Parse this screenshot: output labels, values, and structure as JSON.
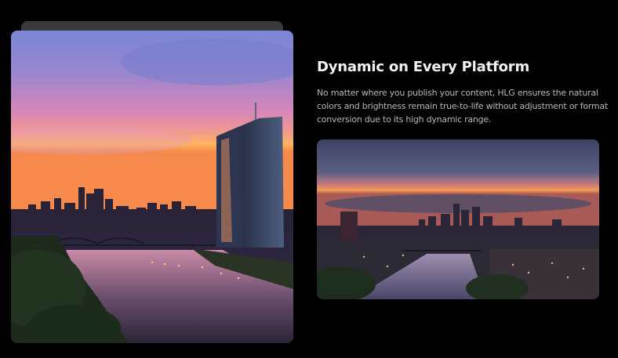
{
  "section": {
    "headline": "Dynamic on Every Platform",
    "body": "No matter where you publish your content, HLG ensures the natural colors and brightness remain true-to-life without adjustment or format conversion due to its high dynamic range."
  },
  "images": {
    "large": "frankfurt-skyline-sunset-tower-photo",
    "small": "frankfurt-skyline-dusk-river-photo"
  },
  "colors": {
    "background": "#000000",
    "headline": "#f1f1f1",
    "body_text": "#b8b8b8",
    "back_card": "#3a3a3c"
  }
}
